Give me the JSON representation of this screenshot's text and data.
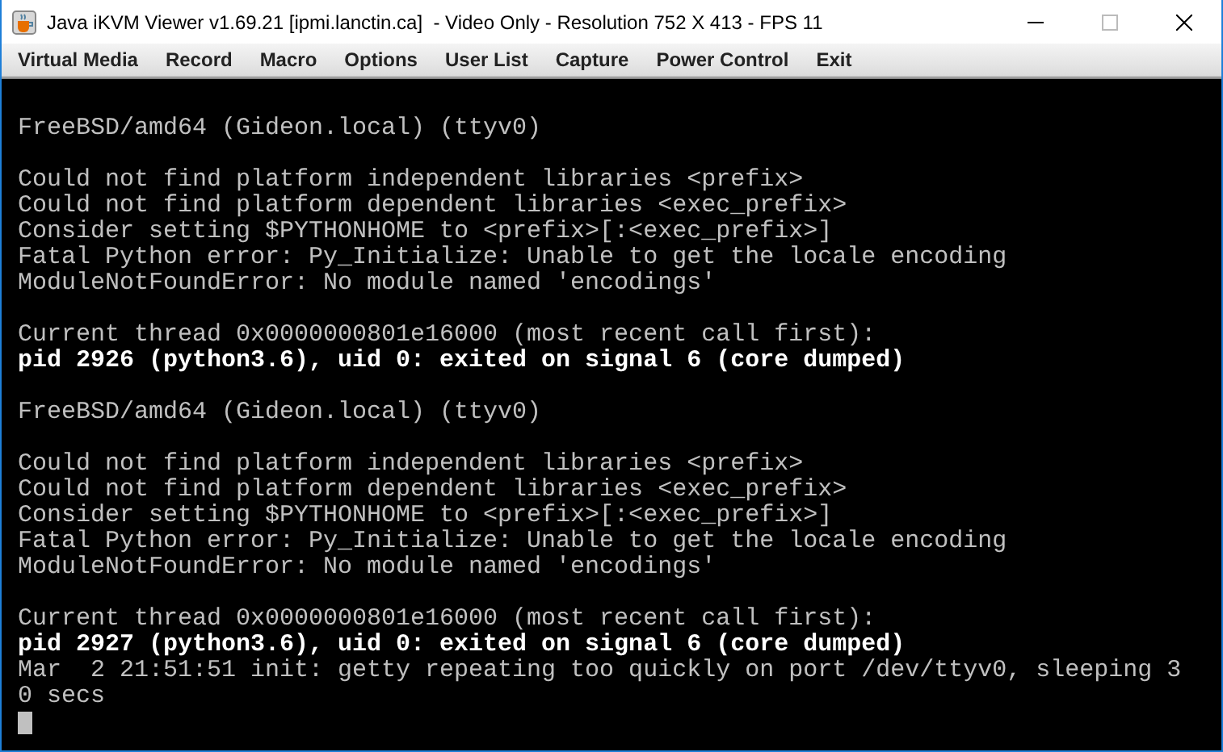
{
  "window": {
    "title": "Java iKVM Viewer v1.69.21 [ipmi.lanctin.ca]  - Video Only - Resolution 752 X 413 - FPS 11"
  },
  "menu": [
    "Virtual Media",
    "Record",
    "Macro",
    "Options",
    "User List",
    "Capture",
    "Power Control",
    "Exit"
  ],
  "console": {
    "blocks": [
      [
        {
          "text": "FreeBSD/amd64 (Gideon.local) (ttyv0)",
          "bright": false
        }
      ],
      [
        {
          "text": "Could not find platform independent libraries <prefix>",
          "bright": false
        },
        {
          "text": "Could not find platform dependent libraries <exec_prefix>",
          "bright": false
        },
        {
          "text": "Consider setting $PYTHONHOME to <prefix>[:<exec_prefix>]",
          "bright": false
        },
        {
          "text": "Fatal Python error: Py_Initialize: Unable to get the locale encoding",
          "bright": false
        },
        {
          "text": "ModuleNotFoundError: No module named 'encodings'",
          "bright": false
        }
      ],
      [
        {
          "text": "Current thread 0x0000000801e16000 (most recent call first):",
          "bright": false
        },
        {
          "text": "pid 2926 (python3.6), uid 0: exited on signal 6 (core dumped)",
          "bright": true
        }
      ],
      [
        {
          "text": "FreeBSD/amd64 (Gideon.local) (ttyv0)",
          "bright": false
        }
      ],
      [
        {
          "text": "Could not find platform independent libraries <prefix>",
          "bright": false
        },
        {
          "text": "Could not find platform dependent libraries <exec_prefix>",
          "bright": false
        },
        {
          "text": "Consider setting $PYTHONHOME to <prefix>[:<exec_prefix>]",
          "bright": false
        },
        {
          "text": "Fatal Python error: Py_Initialize: Unable to get the locale encoding",
          "bright": false
        },
        {
          "text": "ModuleNotFoundError: No module named 'encodings'",
          "bright": false
        }
      ],
      [
        {
          "text": "Current thread 0x0000000801e16000 (most recent call first):",
          "bright": false
        },
        {
          "text": "pid 2927 (python3.6), uid 0: exited on signal 6 (core dumped)",
          "bright": true
        },
        {
          "text": "Mar  2 21:51:51 init: getty repeating too quickly on port /dev/ttyv0, sleeping 3",
          "bright": false
        },
        {
          "text": "0 secs",
          "bright": false
        }
      ]
    ],
    "cursor": true
  }
}
